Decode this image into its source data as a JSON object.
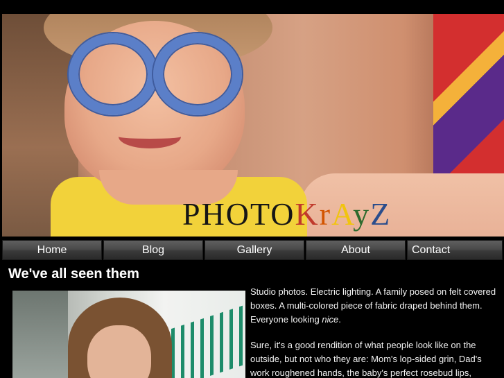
{
  "header": {
    "logo_main": "PHOTO",
    "logo_k": "K",
    "logo_r": "r",
    "logo_a": "A",
    "logo_y": "y",
    "logo_z": "Z"
  },
  "nav": {
    "items": [
      {
        "label": "Home"
      },
      {
        "label": "Blog"
      },
      {
        "label": "Gallery"
      },
      {
        "label": "About"
      },
      {
        "label": "Contact"
      }
    ]
  },
  "main": {
    "heading": "We've all seen them",
    "para1_start": "Studio photos. Electric lighting. A family posed on felt covered boxes. A multi-colored piece of fabric draped behind them. Everyone looking ",
    "para1_emph": "nice",
    "para1_end": ".",
    "para2": "Sure, it's a good rendition of what people look like on the outside, but not who they are: Mom's lop-sided grin, Dad's work roughened hands, the baby's perfect rosebud lips,"
  },
  "colors": {
    "background": "#000000",
    "nav_bg": "#4a4a4a",
    "text": "#f2f2f2"
  }
}
